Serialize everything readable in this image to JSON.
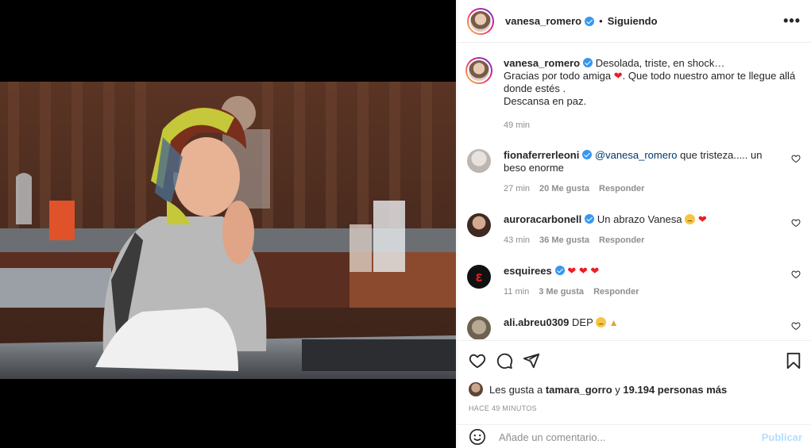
{
  "post": {
    "media_alt": "",
    "author": "vanesa_romero",
    "follow_state": "Siguiendo",
    "separator": "•",
    "more_label": "•••"
  },
  "caption": {
    "author": "vanesa_romero",
    "line1": "Desolada, triste, en shock…",
    "line2a": "Gracias por todo amiga",
    "line2b": ". Que todo nuestro amor te llegue allá",
    "line3": "donde estés .",
    "line4": "Descansa en paz.",
    "time": "49 min"
  },
  "comments": [
    {
      "user": "fionaferrerleoni",
      "mention": "@vanesa_romero",
      "text": "que tristeza..... un beso enorme",
      "time": "27 min",
      "likes": "20 Me gusta",
      "reply": "Responder"
    },
    {
      "user": "auroracarbonell",
      "text": "Un abrazo Vanesa",
      "time": "43 min",
      "likes": "36 Me gusta",
      "reply": "Responder"
    },
    {
      "user": "esquirees",
      "text": "",
      "time": "11 min",
      "likes": "3 Me gusta",
      "reply": "Responder"
    },
    {
      "user": "ali.abreu0309",
      "text": "DEP"
    }
  ],
  "likes": {
    "prefix": "Les gusta a",
    "user": "tamara_gorro",
    "and": "y",
    "count": "19.194 personas más"
  },
  "posted_ago": "HACE 49 MINUTOS",
  "add_comment": {
    "placeholder": "Añade un comentario...",
    "publish": "Publicar"
  },
  "icons": {
    "like": "heart-icon",
    "comment": "comment-icon",
    "share": "share-icon",
    "save": "bookmark-icon",
    "emoji": "emoji-icon"
  },
  "colors": {
    "verified": "#3897f0",
    "mention": "#00376b",
    "publish_disabled": "#b2dffc",
    "muted": "#8e8e8e"
  }
}
